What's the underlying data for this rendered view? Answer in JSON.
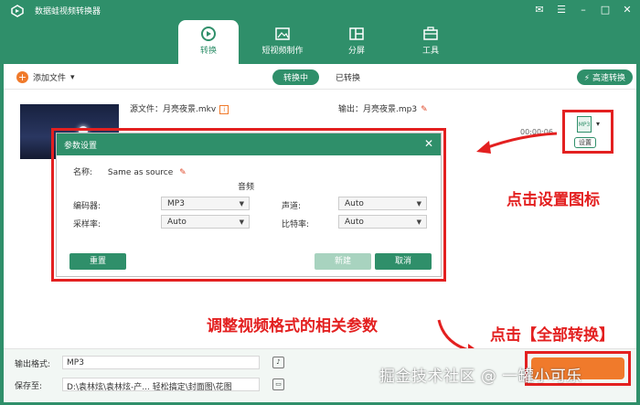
{
  "app": {
    "title": "数据蛙视频转换器"
  },
  "nav": {
    "tabs": [
      {
        "label": "转换",
        "icon": "convert-icon",
        "active": true
      },
      {
        "label": "短视频制作",
        "icon": "mv-icon"
      },
      {
        "label": "分屏",
        "icon": "split-screen-icon"
      },
      {
        "label": "工具",
        "icon": "toolbox-icon"
      }
    ]
  },
  "toolbar": {
    "add_file": "添加文件",
    "converting": "转换中",
    "converted": "已转换",
    "speed": "高速转换"
  },
  "file": {
    "source_label": "源文件：",
    "source_name": "月亮夜景.mkv",
    "output_label": "输出：",
    "output_name": "月亮夜景.mp3",
    "duration": "00:00:06",
    "format_badge": "MP3",
    "settings_label": "设置"
  },
  "dialog": {
    "title": "参数设置",
    "name_label": "名称:",
    "name_value": "Same as source",
    "section": "音频",
    "encoder_label": "编码器:",
    "encoder_value": "MP3",
    "channel_label": "声道:",
    "channel_value": "Auto",
    "samplerate_label": "采样率:",
    "samplerate_value": "Auto",
    "bitrate_label": "比特率:",
    "bitrate_value": "Auto",
    "reset": "重置",
    "new": "新建",
    "cancel": "取消"
  },
  "annotations": {
    "click_settings": "点击设置图标",
    "adjust": "调整视频格式的相关参数",
    "convert_all": "点击【全部转换】"
  },
  "bottom": {
    "format_label": "输出格式:",
    "format_value": "MP3",
    "save_label": "保存至:",
    "save_value": "D:\\袁林炫\\袁林炫-产...    轻松搞定\\封面图\\花图"
  },
  "watermark": "掘金技术社区 @ 一罐小可乐",
  "colors": {
    "brand": "#2f8f6a",
    "accent": "#f07a2b",
    "annotation": "#e32020"
  }
}
